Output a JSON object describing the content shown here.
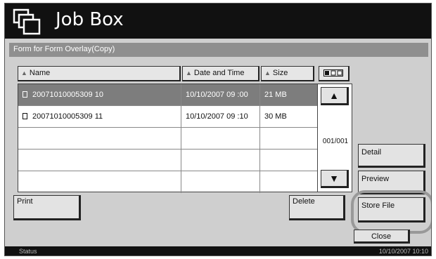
{
  "window": {
    "title": "Job Box"
  },
  "subheader": "Form for Form Overlay(Copy)",
  "columns": {
    "name": "Name",
    "date": "Date and Time",
    "size": "Size"
  },
  "rows": [
    {
      "name": "20071010005309 10",
      "date": "10/10/2007 09 :00",
      "size": "21 MB",
      "selected": true
    },
    {
      "name": "20071010005309 11",
      "date": "10/10/2007 09 :10",
      "size": "30 MB",
      "selected": false
    }
  ],
  "pager": {
    "page": "001/001"
  },
  "buttons": {
    "detail": "Detail",
    "preview": "Preview",
    "print": "Print",
    "delete": "Delete",
    "store_file": "Store File",
    "close": "Close"
  },
  "status": {
    "label": "Status",
    "datetime": "10/10/2007  10:10"
  },
  "icons": {
    "title": "job-box-icon",
    "view": "view-toggle-icon",
    "sort": "sort-triangle-icon",
    "up": "scroll-up-icon",
    "down": "scroll-down-icon",
    "file": "file-icon"
  },
  "colors": {
    "titlebar": "#111111",
    "selected_row": "#7d7d7d",
    "subheader": "#8f8f8f"
  }
}
